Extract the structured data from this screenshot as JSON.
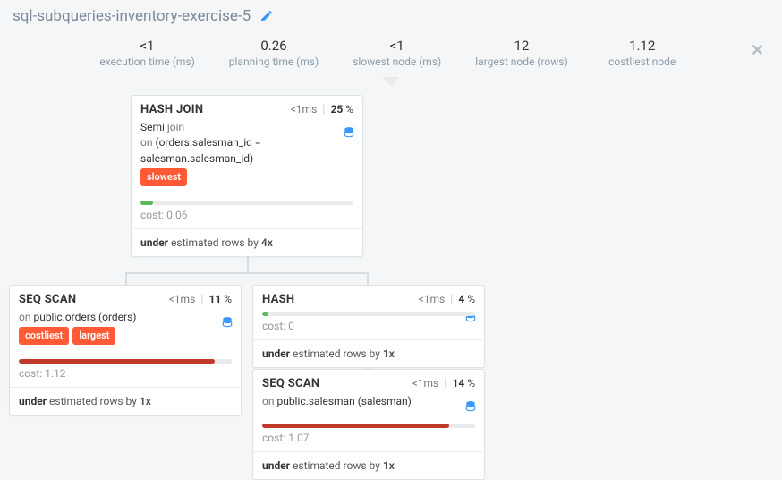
{
  "title": "sql-subqueries-inventory-exercise-5",
  "stats": [
    {
      "value": "<1",
      "label": "execution time (ms)"
    },
    {
      "value": "0.26",
      "label": "planning time (ms)"
    },
    {
      "value": "<1",
      "label": "slowest node (ms)"
    },
    {
      "value": "12",
      "label": "largest node (rows)"
    },
    {
      "value": "1.12",
      "label": "costliest node"
    }
  ],
  "nodes": {
    "hashjoin": {
      "name": "HASH JOIN",
      "time": "<1ms",
      "pct": "25",
      "sub1": "Semi",
      "sub1b": "join",
      "sub2a": "on",
      "sub2b": "(orders.salesman_id = salesman.salesman_id)",
      "tag": "slowest",
      "cost": "cost: 0.06",
      "est_u": "under",
      "est_t": " estimated rows by ",
      "est_x": "4x"
    },
    "seqscan1": {
      "name": "SEQ SCAN",
      "time": "<1ms",
      "pct": "11",
      "suba": "on",
      "subb": "public.orders (orders)",
      "tag1": "costliest",
      "tag2": "largest",
      "cost": "cost: 1.12",
      "est_u": "under",
      "est_t": " estimated rows by ",
      "est_x": "1x"
    },
    "hash": {
      "name": "HASH",
      "time": "<1ms",
      "pct": "4",
      "cost": "cost: 0",
      "est_u": "under",
      "est_t": " estimated rows by ",
      "est_x": "1x"
    },
    "seqscan2": {
      "name": "SEQ SCAN",
      "time": "<1ms",
      "pct": "14",
      "suba": "on",
      "subb": "public.salesman (salesman)",
      "cost": "cost: 1.07",
      "est_u": "under",
      "est_t": " estimated rows by ",
      "est_x": "1x"
    }
  }
}
